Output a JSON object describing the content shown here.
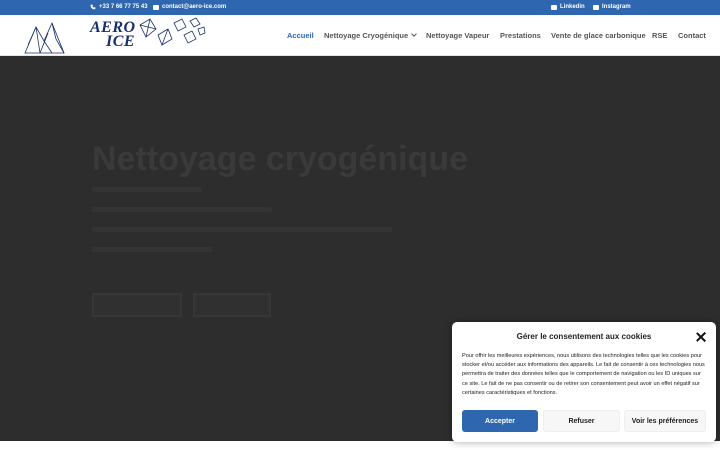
{
  "topbar": {
    "phone": "+33 7 66 77 75 43",
    "email": "contact@aero-ice.com",
    "linkedin": "Linkedin",
    "instagram": "Instagram",
    "bg_color": "#2e66b0"
  },
  "logo": {
    "line1": "AERO",
    "line2": "ICE"
  },
  "nav": {
    "items": [
      {
        "label": "Accueil",
        "active": true
      },
      {
        "label": "Nettoyage Cryogénique",
        "has_dropdown": true
      },
      {
        "label": "Nettoyage Vapeur"
      },
      {
        "label": "Prestations"
      },
      {
        "label": "Vente de glace carbonique"
      },
      {
        "label": "RSE"
      },
      {
        "label": "Contact"
      }
    ],
    "active_color": "#2e66b0"
  },
  "hero": {
    "title": "Nettoyage cryogénique",
    "bg_color": "#2d2d2d"
  },
  "cookie": {
    "title": "Gérer le consentement aux cookies",
    "text": "Pour offrir les meilleures expériences, nous utilisons des technologies telles que les cookies pour stocker et/ou accéder aux informations des appareils. Le fait de consentir à ces technologies nous permettra de traiter des données telles que le comportement de navigation ou les ID uniques sur ce site. Le fait de ne pas consentir ou de retirer son consentement peut avoir un effet négatif sur certaines caractéristiques et fonctions.",
    "accept_label": "Accepter",
    "refuse_label": "Refuser",
    "prefs_label": "Voir les préférences"
  }
}
